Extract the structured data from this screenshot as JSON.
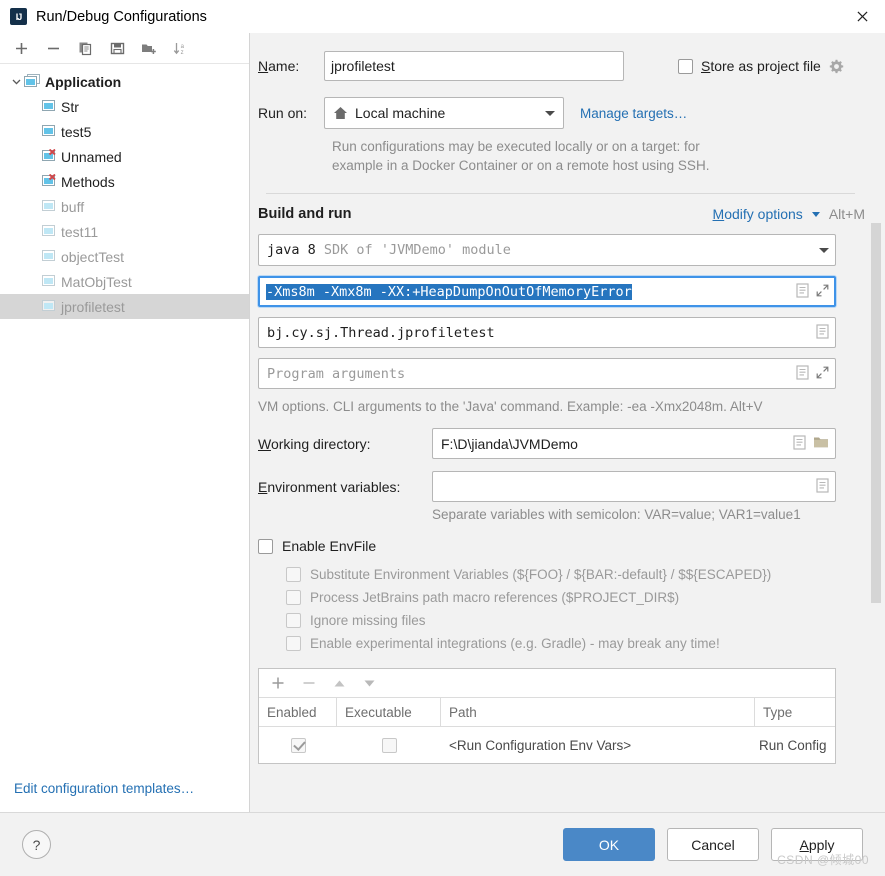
{
  "window": {
    "title": "Run/Debug Configurations",
    "app_icon": "intellij-idea-icon",
    "close_icon": "close-icon"
  },
  "sidebar": {
    "toolbar": [
      {
        "name": "add-configuration-button",
        "icon": "plus-icon"
      },
      {
        "name": "remove-configuration-button",
        "icon": "minus-icon"
      },
      {
        "name": "copy-configuration-button",
        "icon": "copy-icon"
      },
      {
        "name": "save-configuration-button",
        "icon": "save-icon"
      },
      {
        "name": "move-into-new-folder-button",
        "icon": "new-folder-icon"
      },
      {
        "name": "sort-configurations-button",
        "icon": "sort-alphabetically-icon"
      }
    ],
    "tree": [
      {
        "label": "Application",
        "level": 0,
        "group": true,
        "expanded": true,
        "dim": false,
        "error": false,
        "selected": false
      },
      {
        "label": "Str",
        "level": 1,
        "group": false,
        "dim": false,
        "error": false,
        "selected": false
      },
      {
        "label": "test5",
        "level": 1,
        "group": false,
        "dim": false,
        "error": false,
        "selected": false
      },
      {
        "label": "Unnamed",
        "level": 1,
        "group": false,
        "dim": false,
        "error": true,
        "selected": false
      },
      {
        "label": "Methods",
        "level": 1,
        "group": false,
        "dim": false,
        "error": true,
        "selected": false
      },
      {
        "label": "buff",
        "level": 1,
        "group": false,
        "dim": true,
        "error": false,
        "selected": false
      },
      {
        "label": "test11",
        "level": 1,
        "group": false,
        "dim": true,
        "error": false,
        "selected": false
      },
      {
        "label": "objectTest",
        "level": 1,
        "group": false,
        "dim": true,
        "error": false,
        "selected": false
      },
      {
        "label": "MatObjTest",
        "level": 1,
        "group": false,
        "dim": true,
        "error": false,
        "selected": false
      },
      {
        "label": "jprofiletest",
        "level": 1,
        "group": false,
        "dim": true,
        "error": false,
        "selected": true
      }
    ],
    "edit_templates_link": "Edit configuration templates…"
  },
  "form": {
    "name_label": "Name:",
    "name_label_mnemonic": "N",
    "name_value": "jprofiletest",
    "store_as_project_file_label": "Store as project file",
    "store_as_project_file_mnemonic": "S",
    "store_as_project_file_checked": false,
    "store_gear_icon": "gear-icon",
    "run_on_label": "Run on:",
    "run_on_value": "Local machine",
    "run_on_icon": "home-icon",
    "manage_targets_link": "Manage targets…",
    "run_on_hint_line1": "Run configurations may be executed locally or on a target: for",
    "run_on_hint_line2": "example in a Docker Container or on a remote host using SSH."
  },
  "build_and_run": {
    "section_title": "Build and run",
    "modify_options_link": "Modify options",
    "modify_options_mnemonic": "M",
    "modify_options_shortcut": "Alt+M",
    "jdk_name": "java 8",
    "jdk_description": "SDK of 'JVMDemo' module",
    "vm_options_value": "-Xms8m -Xmx8m -XX:+HeapDumpOnOutOfMemoryError",
    "vm_options_selected": true,
    "vm_options_icons": [
      "macro-icon",
      "expand-icon"
    ],
    "main_class_value": "bj.cy.sj.Thread.jprofiletest",
    "main_class_icons": [
      "macro-icon"
    ],
    "program_arguments_placeholder": "Program arguments",
    "program_arguments_value": "",
    "program_arguments_icons": [
      "macro-icon",
      "expand-icon"
    ],
    "vm_options_hint": "VM options. CLI arguments to the 'Java' command. Example: -ea -Xmx2048m. Alt+V",
    "working_directory_label": "Working directory:",
    "working_directory_mnemonic": "W",
    "working_directory_value": "F:\\D\\jianda\\JVMDemo",
    "working_directory_icons": [
      "macro-icon",
      "folder-icon"
    ],
    "environment_variables_label": "Environment variables:",
    "environment_variables_mnemonic": "E",
    "environment_variables_value": "",
    "environment_variables_icons": [
      "macro-icon"
    ],
    "environment_variables_hint": "Separate variables with semicolon: VAR=value; VAR1=value1"
  },
  "envfile": {
    "enable_label": "Enable EnvFile",
    "enable_checked": false,
    "options": [
      {
        "label": "Substitute Environment Variables (${FOO} / ${BAR:-default} / $${ESCAPED})",
        "checked": false,
        "disabled": true
      },
      {
        "label": "Process JetBrains path macro references ($PROJECT_DIR$)",
        "checked": false,
        "disabled": true
      },
      {
        "label": "Ignore missing files",
        "checked": false,
        "disabled": true
      },
      {
        "label": "Enable experimental integrations (e.g. Gradle) - may break any time!",
        "checked": false,
        "disabled": true
      }
    ],
    "table": {
      "toolbar": [
        {
          "name": "add-env-file-button",
          "icon": "plus-icon"
        },
        {
          "name": "remove-env-file-button",
          "icon": "minus-icon"
        },
        {
          "name": "move-up-button",
          "icon": "arrow-up-icon"
        },
        {
          "name": "move-down-button",
          "icon": "arrow-down-icon"
        }
      ],
      "columns": [
        "Enabled",
        "Executable",
        "Path",
        "Type"
      ],
      "rows": [
        {
          "enabled": true,
          "executable": false,
          "path": "<Run Configuration Env Vars>",
          "type": "Run Config"
        }
      ]
    }
  },
  "footer": {
    "help_label": "?",
    "ok_label": "OK",
    "cancel_label": "Cancel",
    "apply_label": "Apply",
    "apply_mnemonic": "A",
    "watermark": "CSDN @倾城00"
  },
  "colors": {
    "accent_blue": "#4a88c7",
    "link_blue": "#2470b3",
    "selection_blue": "#2675bf",
    "focus_border": "#3f93e8",
    "selected_row": "#d6d6d6",
    "error_red": "#d0474a",
    "config_icon": "#62c3e8"
  }
}
